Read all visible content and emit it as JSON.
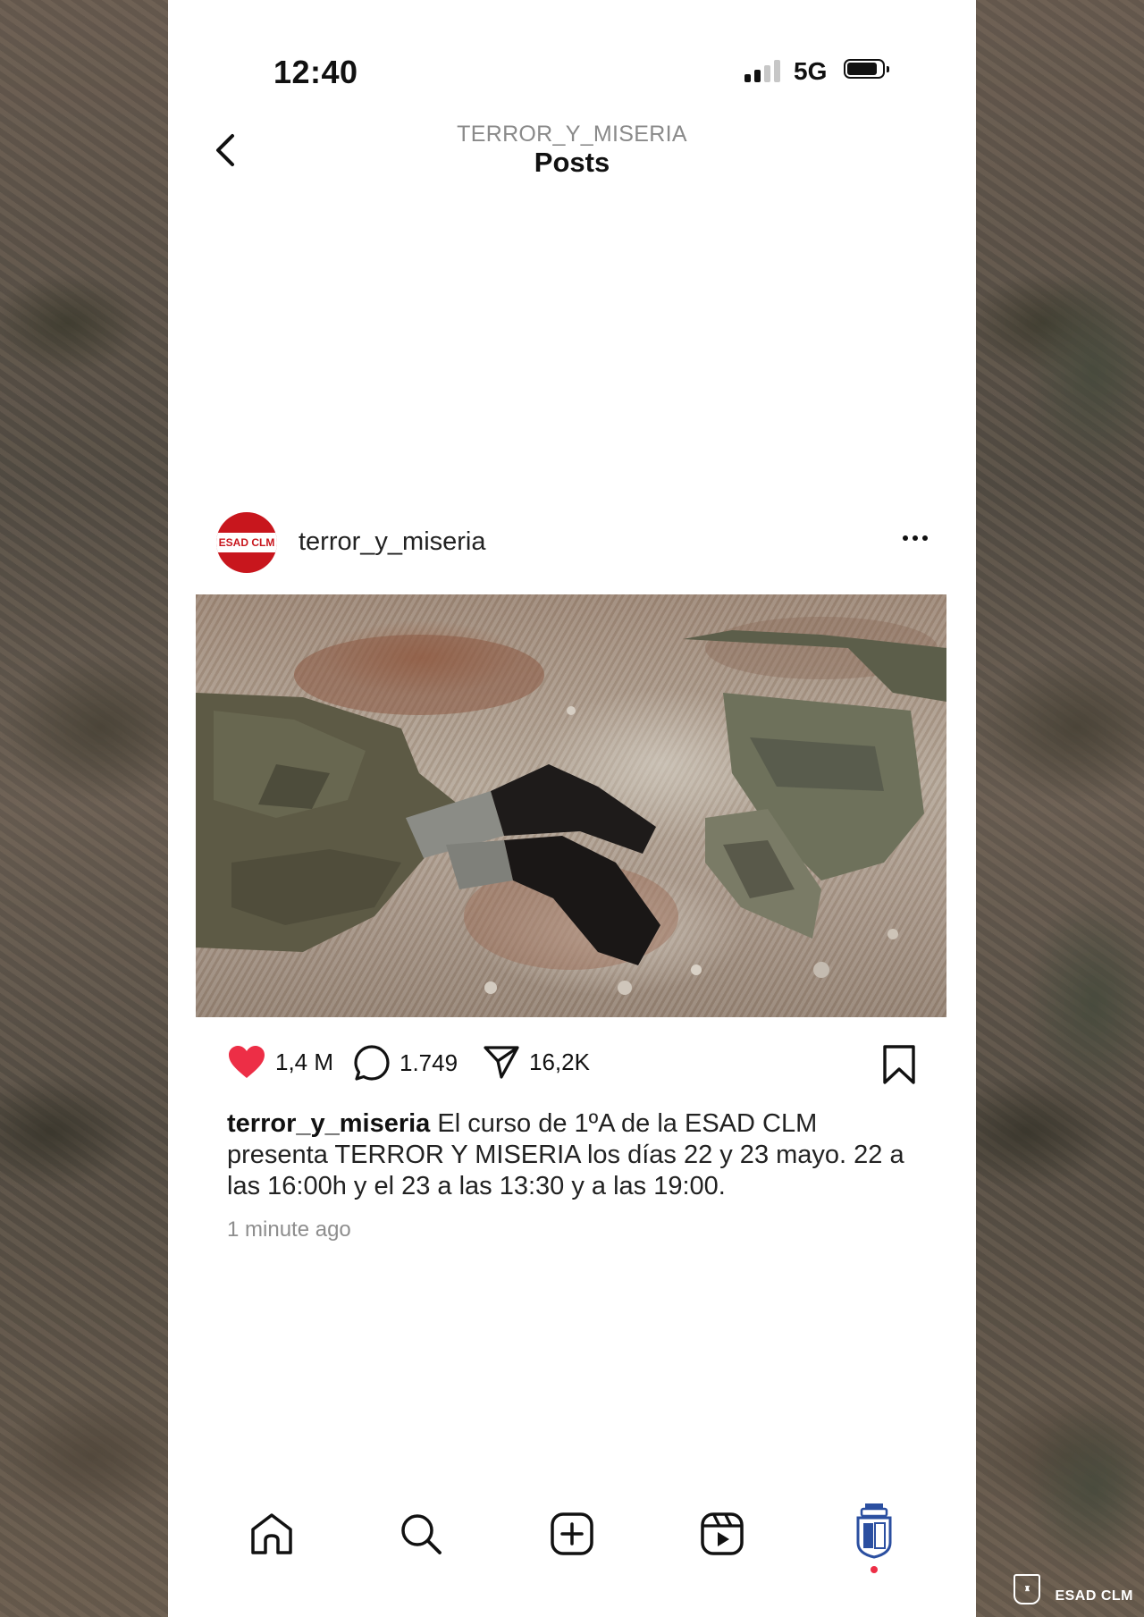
{
  "status_bar": {
    "time": "12:40",
    "network": "5G"
  },
  "header": {
    "account": "TERROR_Y_MISERIA",
    "title": "Posts"
  },
  "post": {
    "username": "terror_y_miseria",
    "avatar_text": "ESAD CLM",
    "likes": "1,4 M",
    "comments": "1.749",
    "shares": "16,2K",
    "caption_user": "terror_y_miseria",
    "caption_text": "El curso de 1ºA de la ESAD CLM presenta TERROR Y MISERIA los días 22 y 23 mayo. 22 a las 16:00h y el 23 a las 13:30 y a las 19:00.",
    "time_ago": "1 minute ago"
  },
  "tabs": [
    {
      "icon": "home-icon"
    },
    {
      "icon": "search-icon"
    },
    {
      "icon": "create-icon"
    },
    {
      "icon": "reels-icon"
    },
    {
      "icon": "profile-icon"
    }
  ],
  "watermark": {
    "esad": "ESAD CLM"
  },
  "colors": {
    "like": "#ed2e46",
    "brand_red": "#c8161d",
    "text": "#111111",
    "muted": "#8e8e8e"
  }
}
